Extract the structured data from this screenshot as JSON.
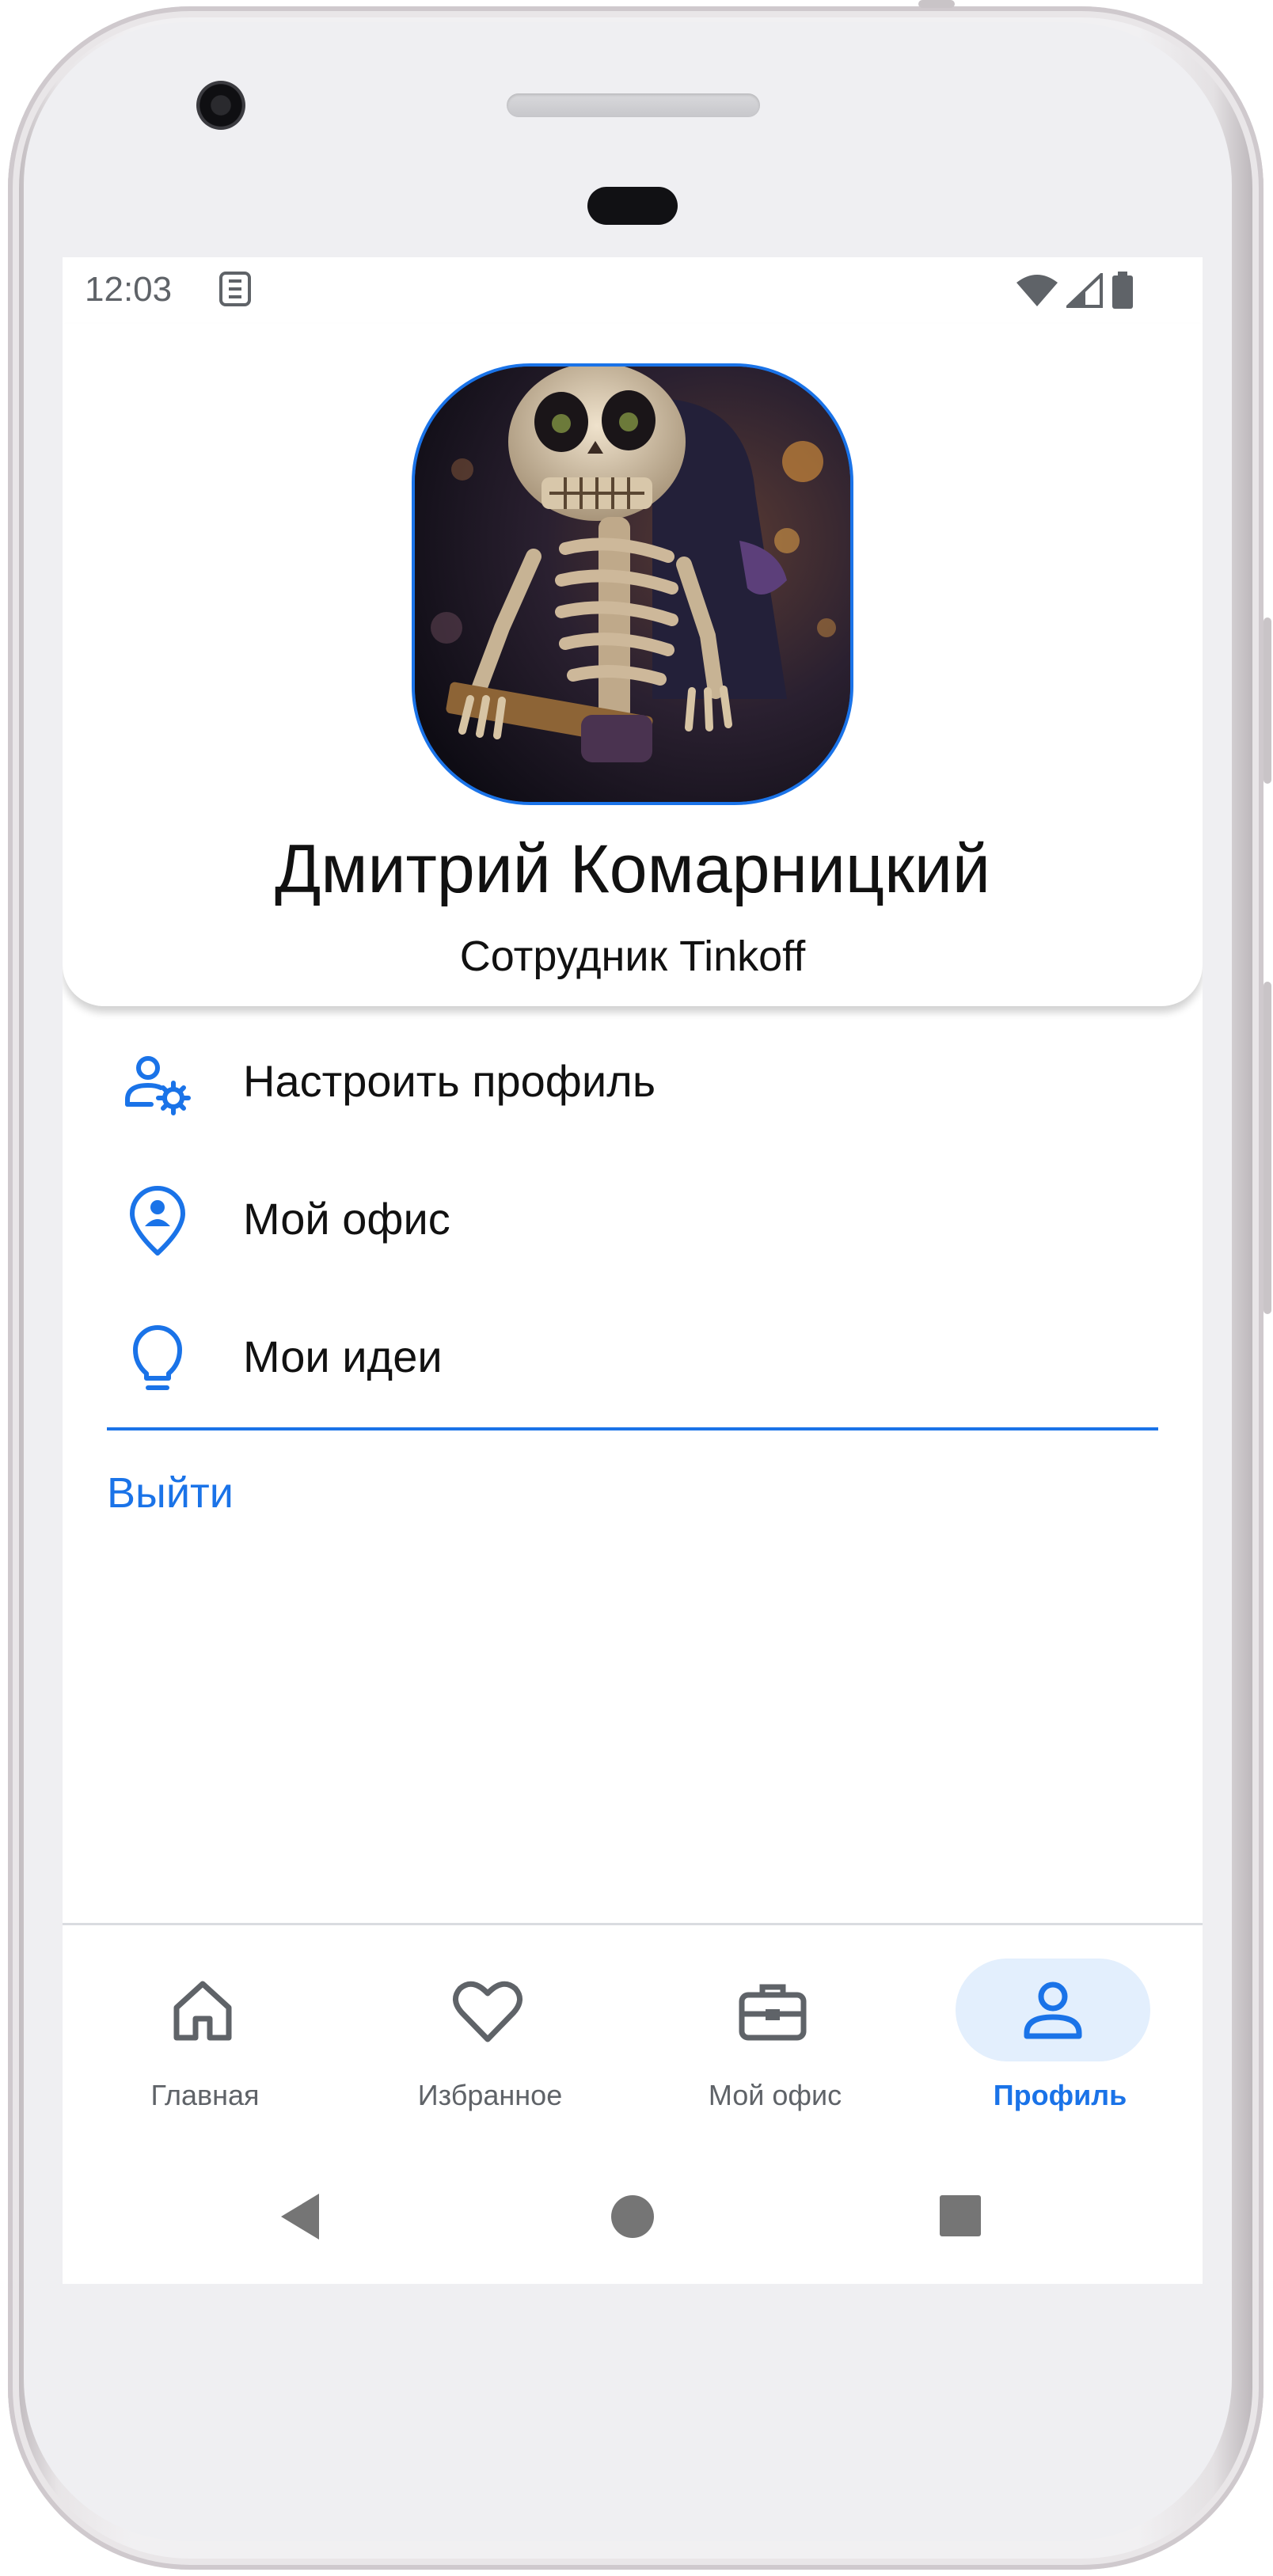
{
  "status_bar": {
    "time": "12:03"
  },
  "profile": {
    "name": "Дмитрий Комарницкий",
    "role": "Сотрудник Tinkoff"
  },
  "menu": {
    "items": [
      {
        "label": "Настроить профиль",
        "icon": "user-settings-icon"
      },
      {
        "label": "Мой офис",
        "icon": "location-pin-person-icon"
      },
      {
        "label": "Мои идеи",
        "icon": "lightbulb-icon"
      }
    ],
    "logout_label": "Выйти"
  },
  "bottom_nav": {
    "items": [
      {
        "label": "Главная",
        "icon": "home-icon",
        "active": false
      },
      {
        "label": "Избранное",
        "icon": "heart-icon",
        "active": false
      },
      {
        "label": "Мой офис",
        "icon": "briefcase-icon",
        "active": false
      },
      {
        "label": "Профиль",
        "icon": "person-icon",
        "active": true
      }
    ]
  },
  "colors": {
    "accent": "#1a73e8",
    "active_pill": "#e3effd",
    "inactive_text": "#5f6368",
    "text": "#111111"
  }
}
